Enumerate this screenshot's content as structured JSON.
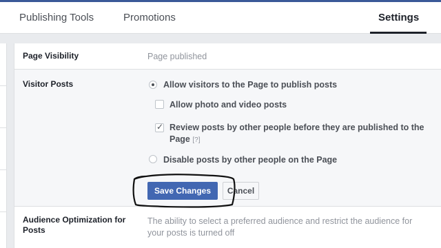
{
  "tabs": {
    "publishing_tools": "Publishing Tools",
    "promotions": "Promotions",
    "settings": "Settings"
  },
  "page_visibility": {
    "label": "Page Visibility",
    "value": "Page published"
  },
  "visitor_posts": {
    "label": "Visitor Posts",
    "options": {
      "allow_visitors": "Allow visitors to the Page to publish posts",
      "allow_photo_video": "Allow photo and video posts",
      "review_line1": "Review posts by other people before they are published to the",
      "review_line2": "Page",
      "help": "[?]",
      "disable_posts": "Disable posts by other people on the Page"
    },
    "selected": "allow_visitors",
    "allow_photo_video_checked": false,
    "review_checked": true,
    "save_label": "Save Changes",
    "cancel_label": "Cancel"
  },
  "audience_optimization": {
    "label_line1": "Audience Optimization for",
    "label_line2": "Posts",
    "value_line1": "The ability to select a preferred audience and restrict the audience for",
    "value_line2": "your posts is turned off"
  },
  "colors": {
    "brand": "#3b5998",
    "button": "#4267b2"
  }
}
